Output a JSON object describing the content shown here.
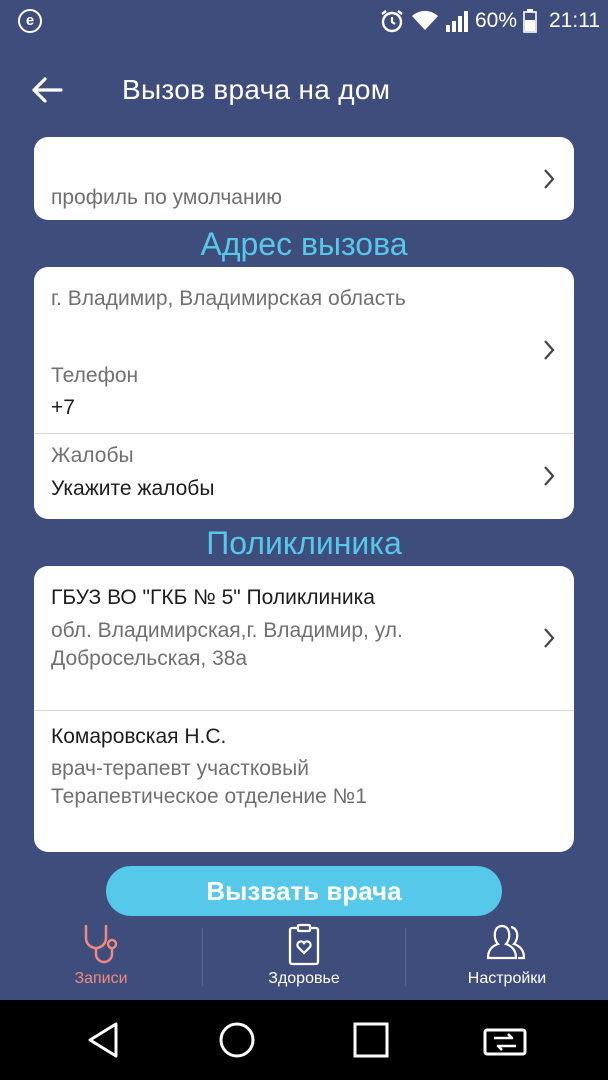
{
  "status": {
    "app_badge": "e",
    "battery": "60%",
    "time": "21:11"
  },
  "header": {
    "title": "Вызов врача на дом"
  },
  "profile": {
    "value": "профиль по умолчанию"
  },
  "address_section": {
    "title": "Адрес вызова",
    "address": "г. Владимир, Владимирская область",
    "phone_label": "Телефон",
    "phone_value": "+7",
    "complaints_label": "Жалобы",
    "complaints_value": "Укажите жалобы"
  },
  "clinic_section": {
    "title": "Поликлиника",
    "clinic_name": "ГБУЗ ВО \"ГКБ № 5\" Поликлиника",
    "clinic_address_line1": "обл. Владимирская,г. Владимир, ул.",
    "clinic_address_line2": "Добросельская, 38а",
    "doctor_name": "Комаровская Н.С.",
    "doctor_position": "врач-терапевт участковый",
    "doctor_department": "Терапевтическое отделение №1"
  },
  "actions": {
    "call_doctor": "Вызвать врача"
  },
  "tabs": [
    {
      "label": "Записи",
      "icon": "stethoscope-icon",
      "active": true
    },
    {
      "label": "Здоровье",
      "icon": "clipboard-heart-icon",
      "active": false
    },
    {
      "label": "Настройки",
      "icon": "people-icon",
      "active": false
    }
  ],
  "colors": {
    "background": "#3f4d7c",
    "accent": "#56c8ea",
    "active_tab": "#f08a80"
  }
}
